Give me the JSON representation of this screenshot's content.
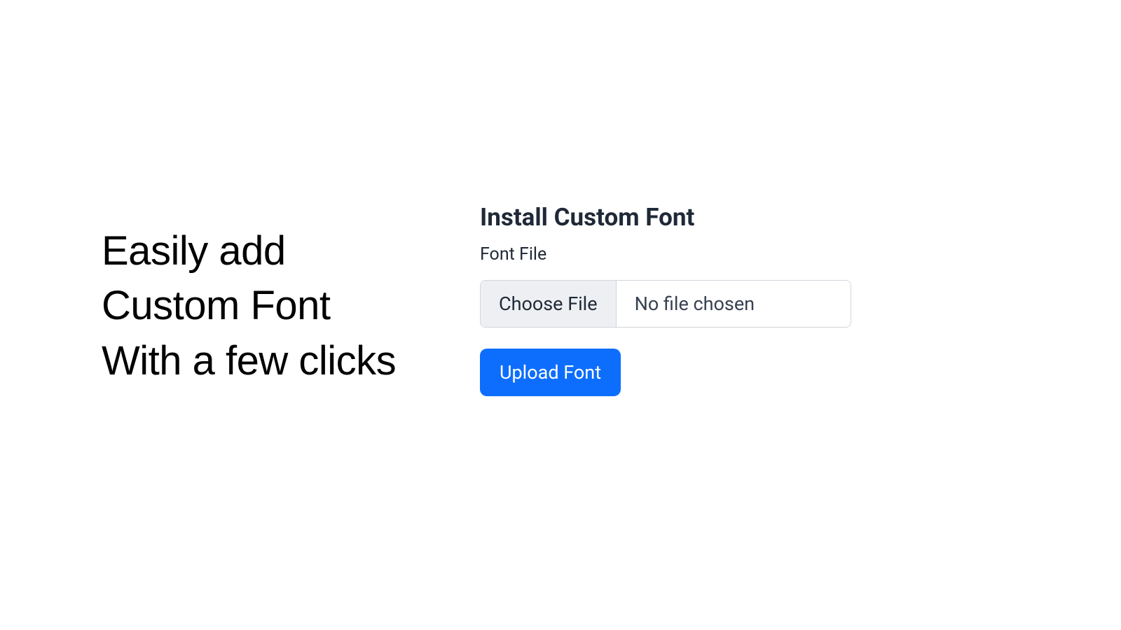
{
  "left": {
    "tagline_line1": "Easily add",
    "tagline_line2": "Custom Font",
    "tagline_line3": "With a few clicks"
  },
  "form": {
    "heading": "Install Custom Font",
    "field_label": "Font File",
    "choose_button_label": "Choose File",
    "file_status": "No file chosen",
    "upload_button_label": "Upload Font"
  }
}
